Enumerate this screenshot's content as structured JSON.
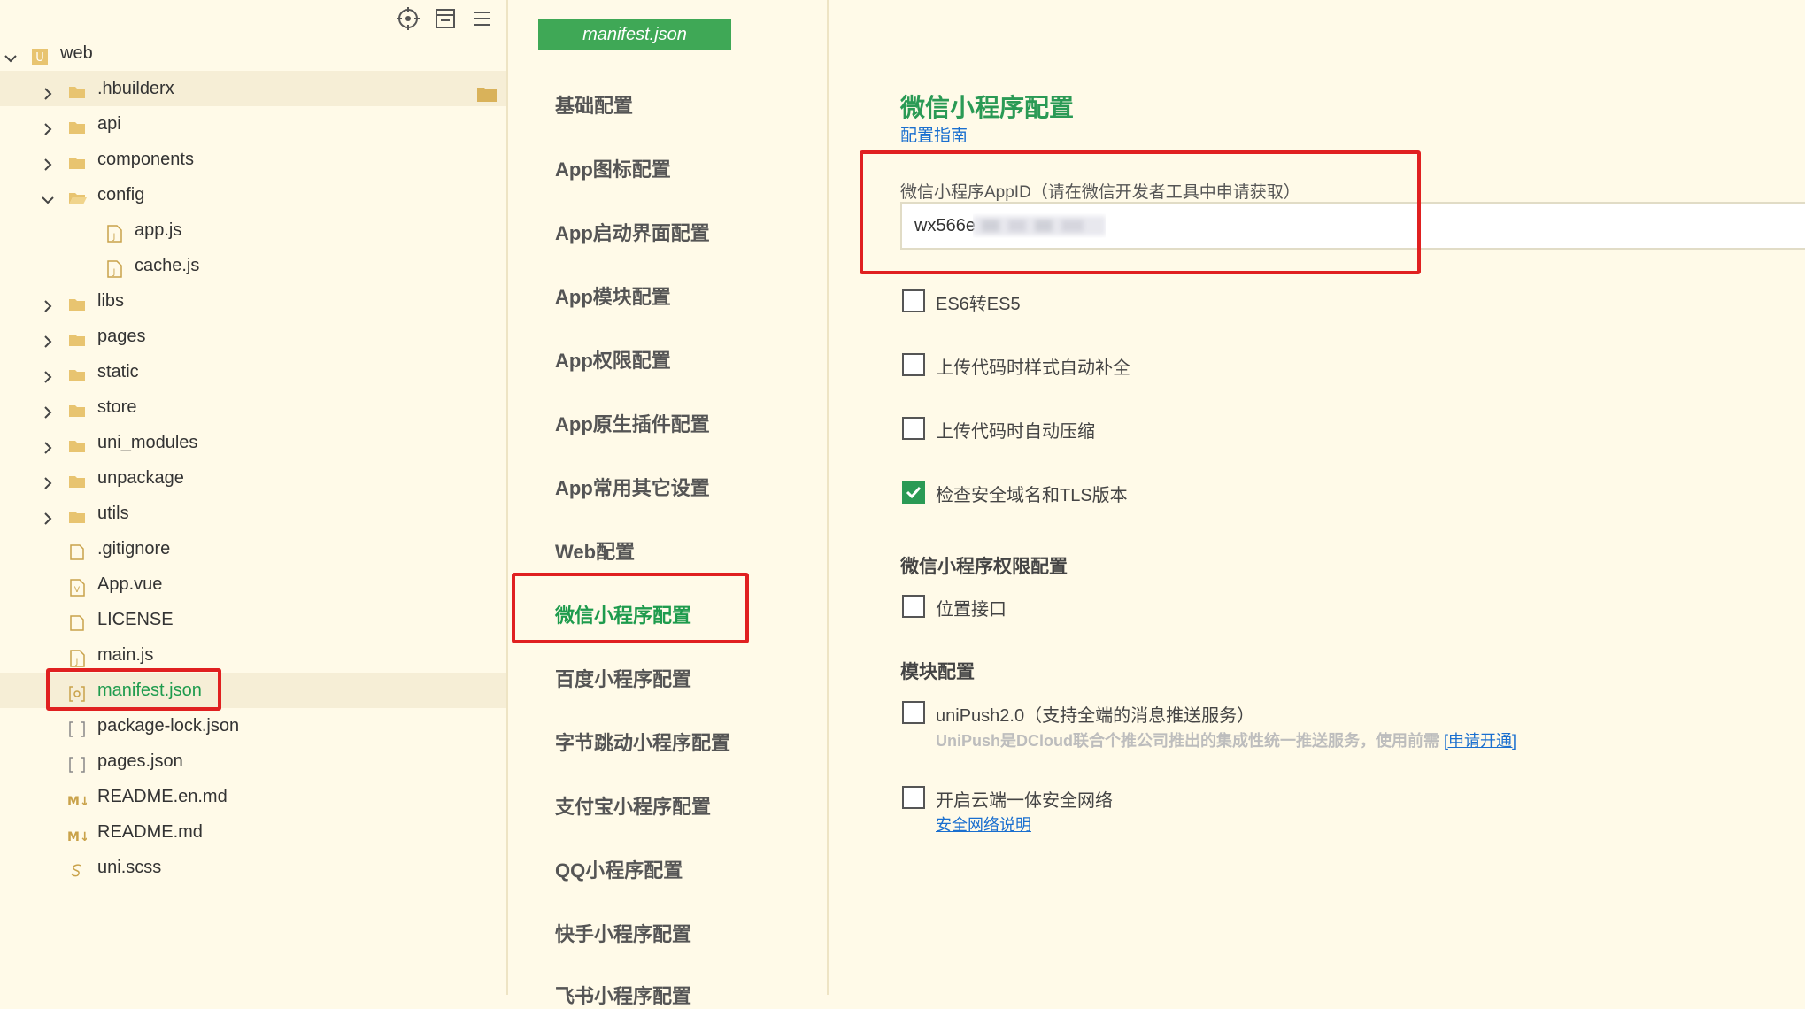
{
  "explorer": {
    "root": "web",
    "items": [
      {
        "label": ".hbuilderx",
        "type": "folder"
      },
      {
        "label": "api",
        "type": "folder"
      },
      {
        "label": "components",
        "type": "folder"
      },
      {
        "label": "config",
        "type": "folder-open"
      },
      {
        "label": "app.js",
        "type": "js"
      },
      {
        "label": "cache.js",
        "type": "js"
      },
      {
        "label": "libs",
        "type": "folder"
      },
      {
        "label": "pages",
        "type": "folder"
      },
      {
        "label": "static",
        "type": "folder"
      },
      {
        "label": "store",
        "type": "folder"
      },
      {
        "label": "uni_modules",
        "type": "folder"
      },
      {
        "label": "unpackage",
        "type": "folder"
      },
      {
        "label": "utils",
        "type": "folder"
      },
      {
        "label": ".gitignore",
        "type": "file"
      },
      {
        "label": "App.vue",
        "type": "vue"
      },
      {
        "label": "LICENSE",
        "type": "file"
      },
      {
        "label": "main.js",
        "type": "js"
      },
      {
        "label": "manifest.json",
        "type": "json-config"
      },
      {
        "label": "package-lock.json",
        "type": "json"
      },
      {
        "label": "pages.json",
        "type": "json"
      },
      {
        "label": "README.en.md",
        "type": "md"
      },
      {
        "label": "README.md",
        "type": "md"
      },
      {
        "label": "uni.scss",
        "type": "scss"
      }
    ]
  },
  "tab": {
    "label": "manifest.json"
  },
  "nav": {
    "items": [
      "基础配置",
      "App图标配置",
      "App启动界面配置",
      "App模块配置",
      "App权限配置",
      "App原生插件配置",
      "App常用其它设置",
      "Web配置",
      "微信小程序配置",
      "百度小程序配置",
      "字节跳动小程序配置",
      "支付宝小程序配置",
      "QQ小程序配置",
      "快手小程序配置",
      "飞书小程序配置"
    ],
    "active": "微信小程序配置"
  },
  "content": {
    "title": "微信小程序配置",
    "guide_link": "配置指南",
    "appid_label": "微信小程序AppID（请在微信开发者工具中申请获取）",
    "appid_value": "wx566e",
    "options": [
      {
        "label": "ES6转ES5",
        "checked": false
      },
      {
        "label": "上传代码时样式自动补全",
        "checked": false
      },
      {
        "label": "上传代码时自动压缩",
        "checked": false
      },
      {
        "label": "检查安全域名和TLS版本",
        "checked": true
      }
    ],
    "perm_section": "微信小程序权限配置",
    "perm_option": "位置接口",
    "module_section": "模块配置",
    "unipush_label": "uniPush2.0（支持全端的消息推送服务）",
    "unipush_hint": "UniPush是DCloud联合个推公司推出的集成性统一推送服务，使用前需",
    "unipush_link": "[申请开通]",
    "secure_label": "开启云端一体安全网络",
    "secure_link": "安全网络说明"
  },
  "colors": {
    "accent": "#2a9a55",
    "highlight_box": "#e02020",
    "background": "#fffae8"
  }
}
